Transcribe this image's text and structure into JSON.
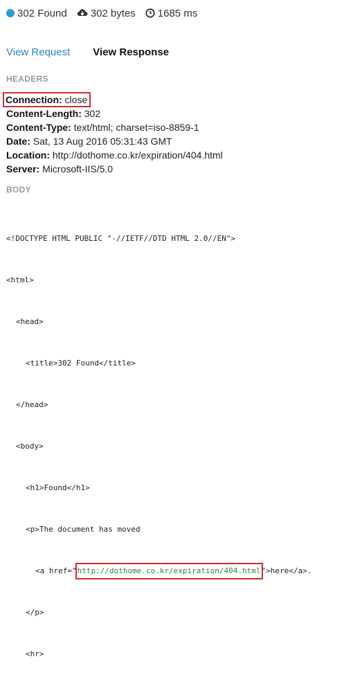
{
  "status": {
    "code_text": "302 Found",
    "status_color": "#2e9bd6",
    "size": "302 bytes",
    "time": "1685 ms",
    "size_icon": "cloud-download-icon",
    "time_icon": "clock-icon"
  },
  "tabs": {
    "request": "View Request",
    "response": "View Response",
    "active": "response"
  },
  "headers_label": "HEADERS",
  "headers": [
    {
      "key": "Connection:",
      "value": "close"
    },
    {
      "key": "Content-Length:",
      "value": "302"
    },
    {
      "key": "Content-Type:",
      "value": "text/html; charset=iso-8859-1"
    },
    {
      "key": "Date:",
      "value": "Sat, 13 Aug 2016 05:31:43 GMT"
    },
    {
      "key": "Location:",
      "value": "http://dothome.co.kr/expiration/404.html"
    },
    {
      "key": "Server:",
      "value": "Microsoft-IIS/5.0"
    }
  ],
  "body_label": "BODY",
  "body": {
    "doctype": "<!DOCTYPE HTML PUBLIC \"-//IETF//DTD HTML 2.0//EN\">",
    "html_open": "<html>",
    "head_open": "<head>",
    "title": "<title>302 Found</title>",
    "head_close": "</head>",
    "body_open": "<body>",
    "h1": "<h1>Found</h1>",
    "p_open": "<p>The document has moved",
    "a_prefix": "<a href=\"",
    "a_href": "http://dothome.co.kr/expiration/404.html",
    "a_suffix": "\">here</a>.",
    "p_close": "</p>",
    "hr": "<hr>"
  },
  "highlight_color": "#d42a2a"
}
